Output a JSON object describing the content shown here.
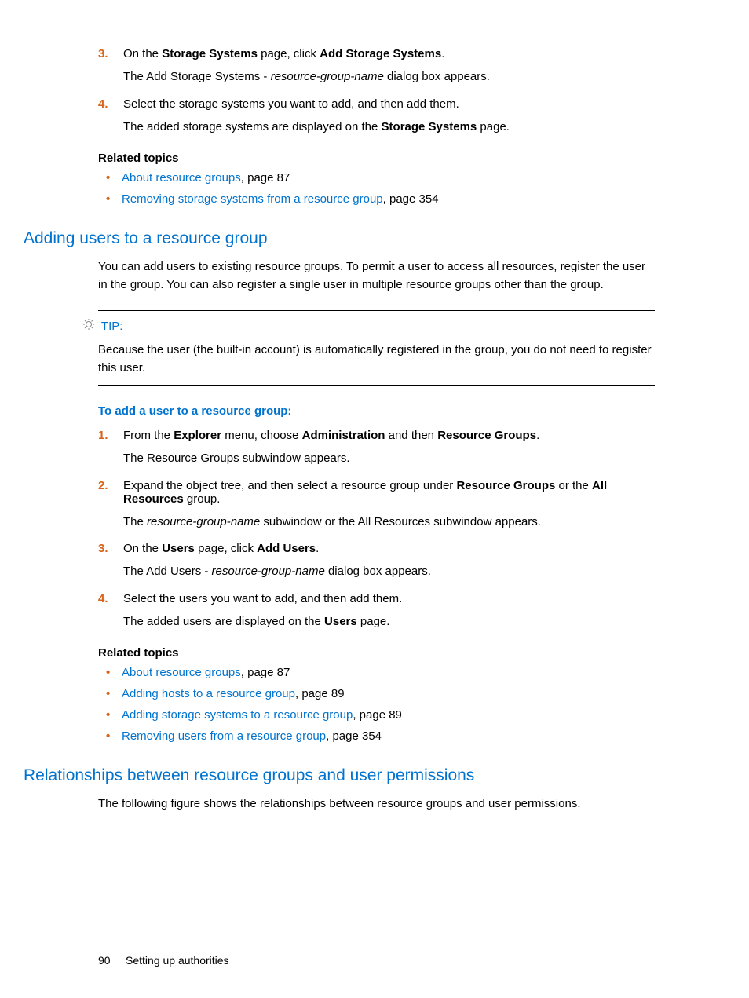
{
  "procA": {
    "s3a": "On the ",
    "s3b": "Storage Systems",
    "s3c": " page, click ",
    "s3d": "Add Storage Systems",
    "s3e": ".",
    "s3f": "The Add Storage Systems - ",
    "s3g": "resource-group-name",
    "s3h": " dialog box appears.",
    "s4a": "Select the storage systems you want to add, and then add them.",
    "s4b": "The added storage systems are displayed on the ",
    "s4c": "Storage Systems",
    "s4d": " page."
  },
  "relatedA": {
    "head": "Related topics",
    "r1link": "About resource groups",
    "r1tail": ", page 87",
    "r2link": "Removing storage systems from a resource group",
    "r2tail": ", page 354"
  },
  "secB": {
    "title": "Adding users to a resource group",
    "p1": "You can add users to existing resource groups. To permit a user to access all resources, register the user in the                               group. You can also register a single user in multiple resource groups other than the                               group."
  },
  "tip": {
    "label": "TIP:",
    "body": "Because the user                 (the built-in account) is automatically registered in the                          group, you do not need to register this user."
  },
  "procBHead": "To add a user to a resource group:",
  "procB": {
    "s1a": "From the ",
    "s1b": "Explorer",
    "s1c": " menu, choose ",
    "s1d": "Administration",
    "s1e": " and then ",
    "s1f": "Resource Groups",
    "s1g": ".",
    "s1h": "The Resource Groups subwindow appears.",
    "s2a": "Expand the object tree, and then select a resource group under ",
    "s2b": "Resource Groups",
    "s2c": " or the ",
    "s2d": "All Resources",
    "s2e": " group.",
    "s2f": "The ",
    "s2g": "resource-group-name",
    "s2h": " subwindow or the All Resources subwindow appears.",
    "s3a": "On the ",
    "s3b": "Users",
    "s3c": " page, click ",
    "s3d": "Add Users",
    "s3e": ".",
    "s3f": "The Add Users - ",
    "s3g": "resource-group-name",
    "s3h": " dialog box appears.",
    "s4a": "Select the users you want to add, and then add them.",
    "s4b": "The added users are displayed on the ",
    "s4c": "Users",
    "s4d": " page."
  },
  "relatedB": {
    "head": "Related topics",
    "r1link": "About resource groups",
    "r1tail": ", page 87",
    "r2link": "Adding hosts to a resource group",
    "r2tail": ", page 89",
    "r3link": "Adding storage systems to a resource group",
    "r3tail": ", page 89",
    "r4link": "Removing users from a resource group",
    "r4tail": ", page 354"
  },
  "secC": {
    "title": "Relationships between resource groups and user permissions",
    "p1": "The following figure shows the relationships between resource groups and user permissions."
  },
  "footer": {
    "num": "90",
    "text": "Setting up authorities"
  }
}
